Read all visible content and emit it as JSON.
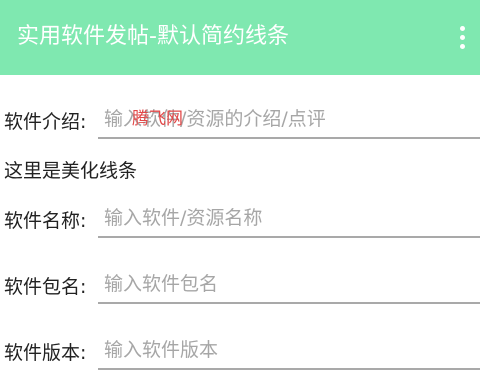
{
  "app_bar": {
    "title": "实用软件发帖-默认简约线条",
    "background_color": "#7fe8b0",
    "overflow_icon": "more-vertical-icon"
  },
  "watermark": "腾飞网",
  "fields": {
    "intro": {
      "label": "软件介绍:",
      "value": "",
      "placeholder": "输入软件/资源的介绍/点评"
    },
    "name": {
      "label": "软件名称:",
      "value": "",
      "placeholder": "输入软件/资源名称"
    },
    "package": {
      "label": "软件包名:",
      "value": "",
      "placeholder": "输入软件包名"
    },
    "version": {
      "label": "软件版本:",
      "value": "",
      "placeholder": "输入软件版本"
    }
  },
  "divider_text": "这里是美化线条",
  "colors": {
    "input_underline": "#a9a9a9",
    "placeholder": "#a6a6a6",
    "watermark": "#e24848"
  }
}
